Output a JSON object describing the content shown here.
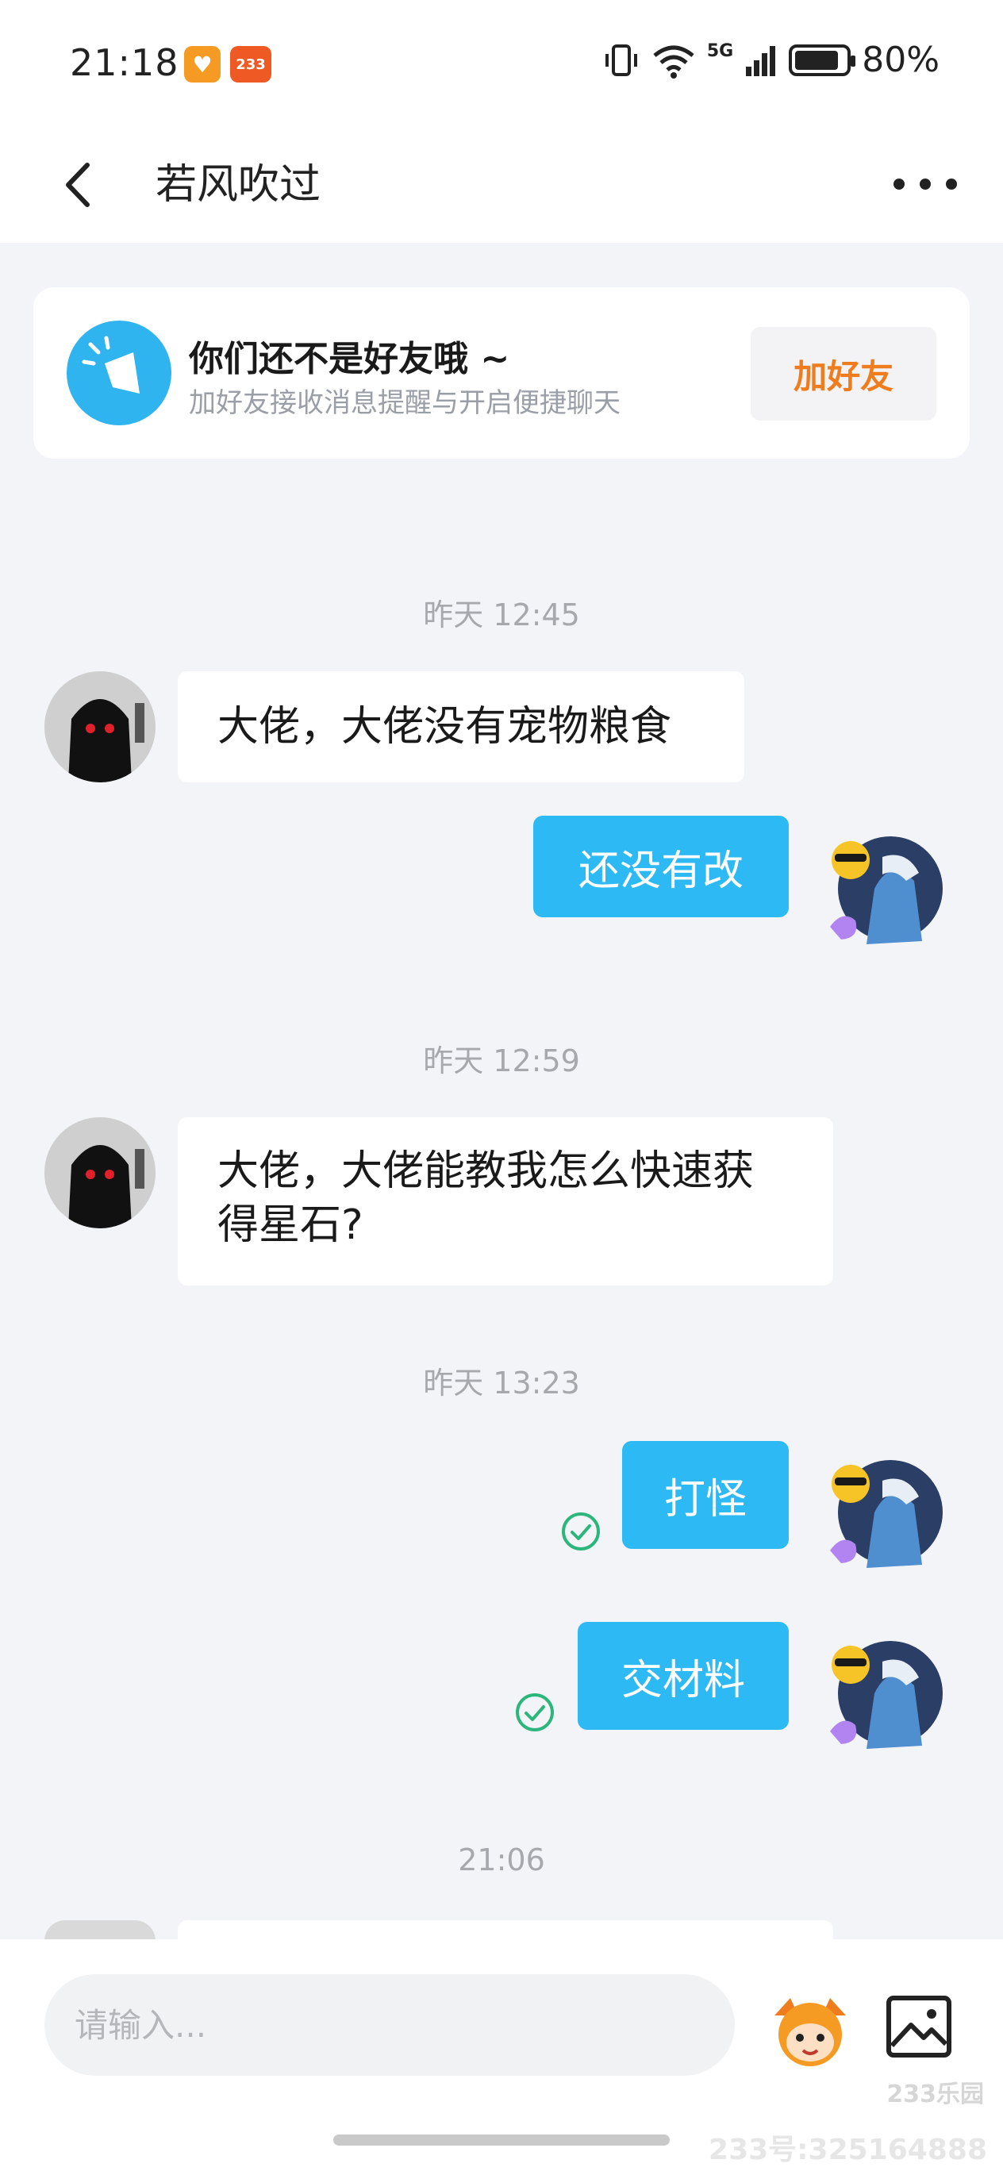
{
  "status_bar": {
    "time": "21:18",
    "app_badge": "233",
    "network": "5G",
    "battery": "80%"
  },
  "header": {
    "title": "若风吹过"
  },
  "friend_card": {
    "title": "你们还不是好友哦 ~",
    "subtitle": "加好友接收消息提醒与开启便捷聊天",
    "button": "加好友"
  },
  "messages": [
    {
      "type": "time",
      "text": "昨天 12:45"
    },
    {
      "type": "in",
      "text": "大佬，大佬没有宠物粮食"
    },
    {
      "type": "out",
      "text": "还没有改"
    },
    {
      "type": "time",
      "text": "昨天 12:59"
    },
    {
      "type": "in",
      "text": "大佬，大佬能教我怎么快速获得星石?"
    },
    {
      "type": "time",
      "text": "昨天 13:23"
    },
    {
      "type": "out",
      "text": "打怪",
      "read": true
    },
    {
      "type": "out",
      "text": "交材料",
      "read": true
    },
    {
      "type": "time",
      "text": "21:06"
    }
  ],
  "input": {
    "placeholder": "请输入..."
  },
  "icons": [
    "back-icon",
    "more-icon",
    "megaphone-icon",
    "check-circle-icon",
    "mascot-icon",
    "image-icon"
  ],
  "colors": {
    "accent_blue": "#2db9f4",
    "button_orange": "#f07d1d",
    "read_green": "#2cb67d"
  },
  "watermark": {
    "logo": "233乐园",
    "id": "233号:325164888"
  }
}
